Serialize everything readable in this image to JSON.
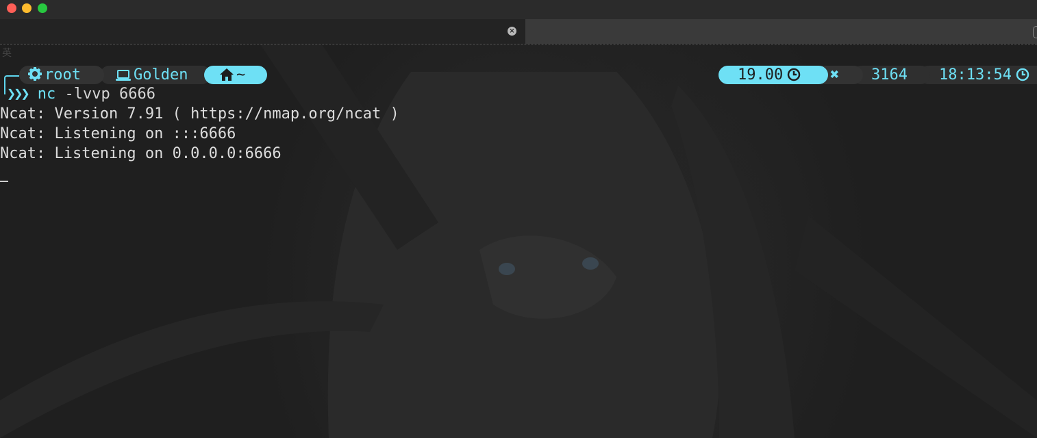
{
  "window": {
    "traffic_lights": [
      "close",
      "minimize",
      "maximize"
    ],
    "tab_close_label": "×"
  },
  "terminal": {
    "ime_indicator": "英",
    "prompt": {
      "user": "root",
      "host": "Golden",
      "directory": "~",
      "arrows": "❯❯❯",
      "command": "nc",
      "arguments": " -lvvp 6666"
    },
    "status_right": {
      "elapsed": "19.00",
      "status_symbol": "✖",
      "pid": "3164",
      "clock": "18:13:54"
    },
    "output": [
      "Ncat: Version 7.91 ( https://nmap.org/ncat )",
      "Ncat: Listening on :::6666",
      "Ncat: Listening on 0.0.0.0:6666"
    ]
  },
  "colors": {
    "accent": "#6ee0f5",
    "background": "#1f1f1f",
    "text": "#dcdcdc"
  }
}
